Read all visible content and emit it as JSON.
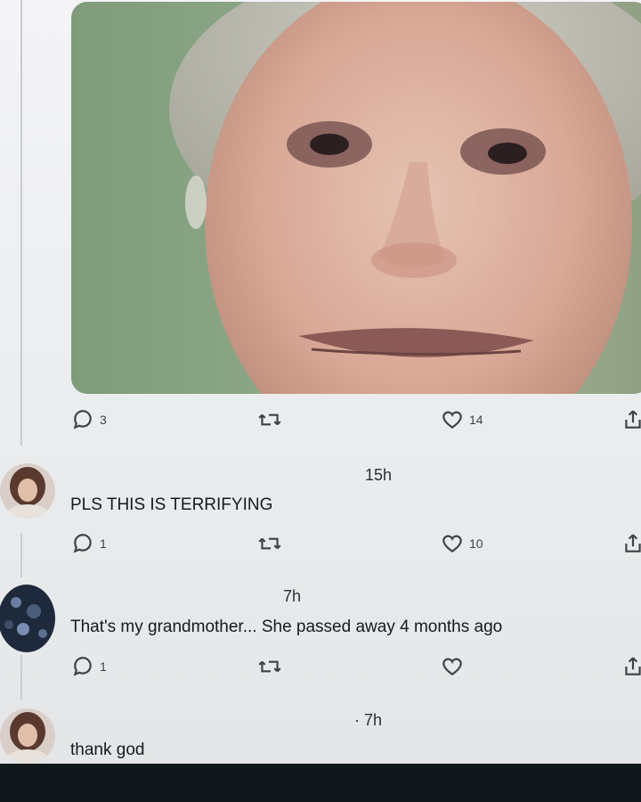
{
  "tweet": {
    "media_alt": "",
    "actions": {
      "replies": "3",
      "retweets": "",
      "likes": "14"
    }
  },
  "replies": [
    {
      "time": "15h",
      "text": "PLS THIS IS TERRIFYING",
      "actions": {
        "replies": "1",
        "retweets": "",
        "likes": "10"
      }
    },
    {
      "time": "7h",
      "text": "That's my grandmother... She passed away 4 months ago",
      "actions": {
        "replies": "1",
        "retweets": "",
        "likes": ""
      }
    },
    {
      "time": "· 7h",
      "text": "thank god"
    }
  ],
  "icons": {
    "reply": "reply-icon",
    "retweet": "retweet-icon",
    "like": "heart-icon",
    "share": "share-icon"
  },
  "colors": {
    "icon": "#3d4146",
    "background": "#eceef0",
    "bottom_bar": "#11181c"
  }
}
